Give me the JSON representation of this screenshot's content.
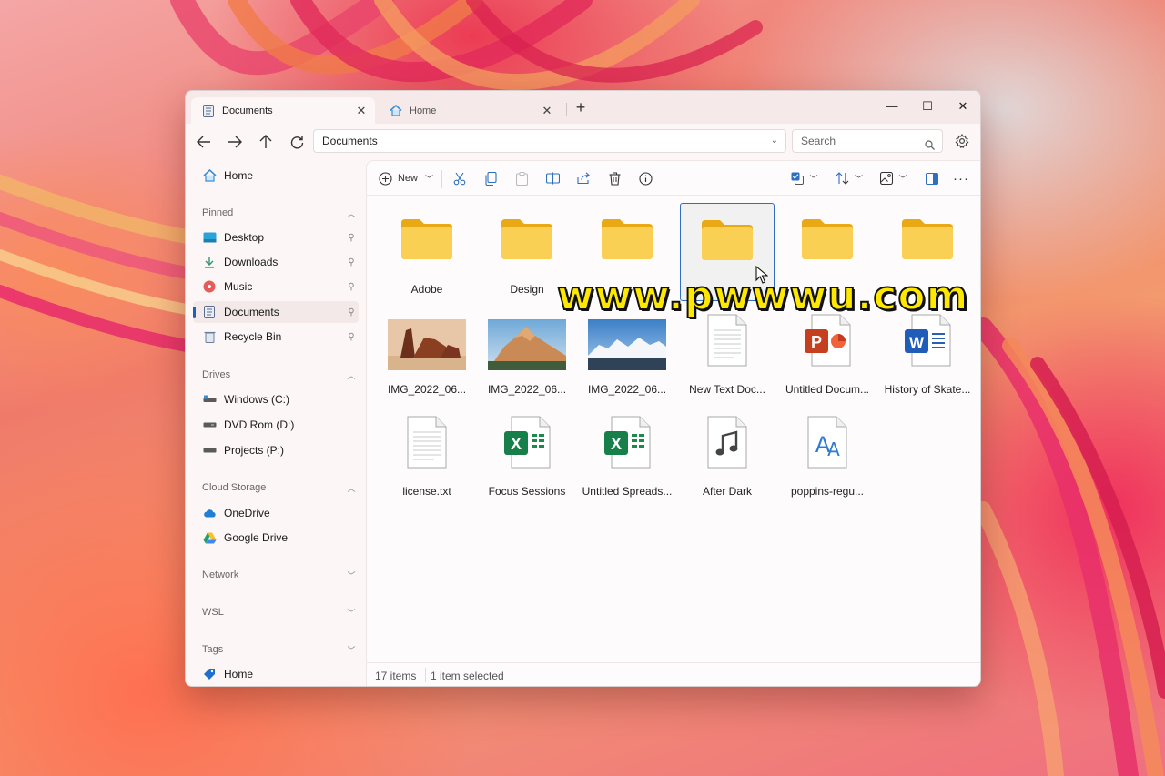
{
  "colors": {
    "accent": "#1f5fbf",
    "folder": "#f7c948",
    "selection_border": "#2f6fbf"
  },
  "tabs": [
    {
      "label": "Documents",
      "icon": "document-icon",
      "active": true
    },
    {
      "label": "Home",
      "icon": "home-icon",
      "active": false
    }
  ],
  "window_controls": {
    "minimize": "—",
    "maximize": "☐",
    "close": "✕"
  },
  "address_bar": {
    "path": "Documents"
  },
  "search": {
    "placeholder": "Search"
  },
  "toolbar": {
    "new_label": "New"
  },
  "sidebar": {
    "home": "Home",
    "pinned": {
      "title": "Pinned",
      "items": [
        "Desktop",
        "Downloads",
        "Music",
        "Documents",
        "Recycle Bin"
      ]
    },
    "drives": {
      "title": "Drives",
      "items": [
        "Windows (C:)",
        "DVD Rom (D:)",
        "Projects (P:)"
      ]
    },
    "cloud": {
      "title": "Cloud Storage",
      "items": [
        "OneDrive",
        "Google Drive"
      ]
    },
    "network": "Network",
    "wsl": "WSL",
    "tags": {
      "title": "Tags",
      "items": [
        "Home"
      ]
    }
  },
  "files": [
    {
      "name": "Adobe",
      "type": "folder"
    },
    {
      "name": "Design",
      "type": "folder"
    },
    {
      "name": "",
      "type": "folder"
    },
    {
      "name": "",
      "type": "folder",
      "selected": true
    },
    {
      "name": "",
      "type": "folder"
    },
    {
      "name": "",
      "type": "folder"
    },
    {
      "name": "IMG_2022_06...",
      "type": "image",
      "scene": "desert"
    },
    {
      "name": "IMG_2022_06...",
      "type": "image",
      "scene": "mountain"
    },
    {
      "name": "IMG_2022_06...",
      "type": "image",
      "scene": "snow"
    },
    {
      "name": "New Text Doc...",
      "type": "text"
    },
    {
      "name": "Untitled Docum...",
      "type": "powerpoint"
    },
    {
      "name": "History of Skate...",
      "type": "word"
    },
    {
      "name": "license.txt",
      "type": "text"
    },
    {
      "name": "Focus Sessions",
      "type": "excel"
    },
    {
      "name": "Untitled Spreads...",
      "type": "excel"
    },
    {
      "name": "After Dark",
      "type": "audio"
    },
    {
      "name": "poppins-regu...",
      "type": "font"
    }
  ],
  "status": {
    "count": "17 items",
    "selection": "1 item selected"
  },
  "watermark": "www.pwwwu.com"
}
